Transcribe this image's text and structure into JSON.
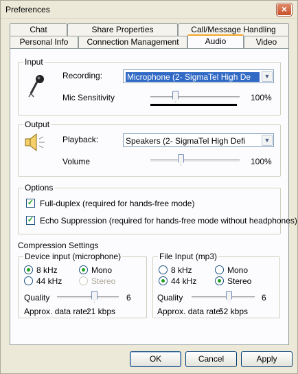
{
  "window": {
    "title": "Preferences",
    "close_glyph": "×"
  },
  "tabs": {
    "row1": [
      "Chat",
      "Share Properties",
      "Call/Message Handling"
    ],
    "row2": [
      "Personal Info",
      "Connection Management",
      "Audio",
      "Video"
    ],
    "active": "Audio"
  },
  "input": {
    "legend": "Input",
    "recording_label": "Recording:",
    "recording_value": "Microphone (2- SigmaTel High De",
    "sensitivity_label": "Mic Sensitivity",
    "sensitivity_value": "100%",
    "sensitivity_level": 100,
    "icon": "microphone-icon"
  },
  "output": {
    "legend": "Output",
    "playback_label": "Playback:",
    "playback_value": "Speakers (2- SigmaTel High Defi",
    "volume_label": "Volume",
    "volume_value": "100%",
    "volume_level": 100,
    "icon": "speaker-icon"
  },
  "options": {
    "legend": "Options",
    "full_duplex": "Full-duplex (required for hands-free mode)",
    "echo_suppression": "Echo Suppression (required for hands-free mode without headphones)",
    "full_duplex_checked": true,
    "echo_suppression_checked": true
  },
  "compression": {
    "title": "Compression Settings",
    "device": {
      "legend": "Device input (microphone)",
      "rate_8": "8 kHz",
      "rate_44": "44 kHz",
      "mono": "Mono",
      "stereo": "Stereo",
      "quality_label": "Quality",
      "quality_value": "6",
      "data_rate_label": "Approx. data rate:",
      "data_rate_value": "21 kbps"
    },
    "file": {
      "legend": "File Input (mp3)",
      "rate_8": "8 kHz",
      "rate_44": "44 kHz",
      "mono": "Mono",
      "stereo": "Stereo",
      "quality_label": "Quality",
      "quality_value": "6",
      "data_rate_label": "Approx. data rate:",
      "data_rate_value": "52 kbps"
    }
  },
  "buttons": {
    "ok": "OK",
    "cancel": "Cancel",
    "apply": "Apply"
  },
  "colors": {
    "accent_tab": "#f5a524",
    "selection": "#316ac5",
    "check": "#21a121"
  }
}
